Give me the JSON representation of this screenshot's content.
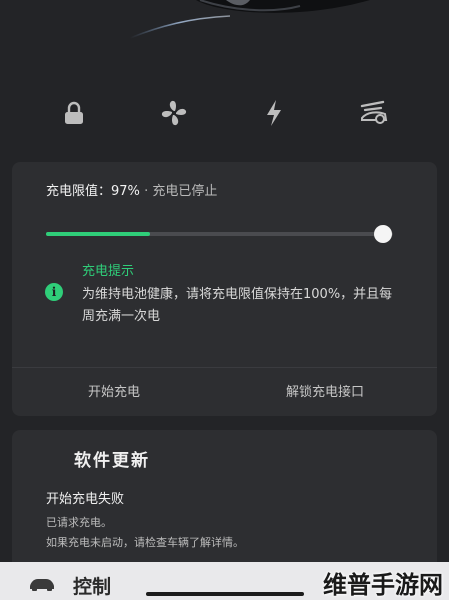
{
  "quick_controls": [
    {
      "icon": "lock-icon"
    },
    {
      "icon": "fan-icon"
    },
    {
      "icon": "lightning-icon"
    },
    {
      "icon": "trunk-icon"
    }
  ],
  "charge": {
    "limit_label": "充电限值：",
    "limit_value": "97%",
    "separator": "·",
    "state": "充电已停止",
    "limit_percent": 97,
    "current_level_fraction": 0.3,
    "accent_color": "#2fce79",
    "tip": {
      "title": "充电提示",
      "icon": "info-icon",
      "icon_glyph": "i",
      "body": "为维持电池健康，请将充电限值保持在100%，并且每周充满一次电"
    },
    "actions": {
      "start": "开始充电",
      "unlock_port": "解锁充电接口"
    }
  },
  "update": {
    "title": "软件更新",
    "subtitle": "开始充电失败",
    "line1": "已请求充电。",
    "line2": "如果充电未启动，请检查车辆了解详情。"
  },
  "bottom_bar": {
    "icon": "car-icon",
    "label": "控制"
  },
  "watermark": "维普手游网"
}
